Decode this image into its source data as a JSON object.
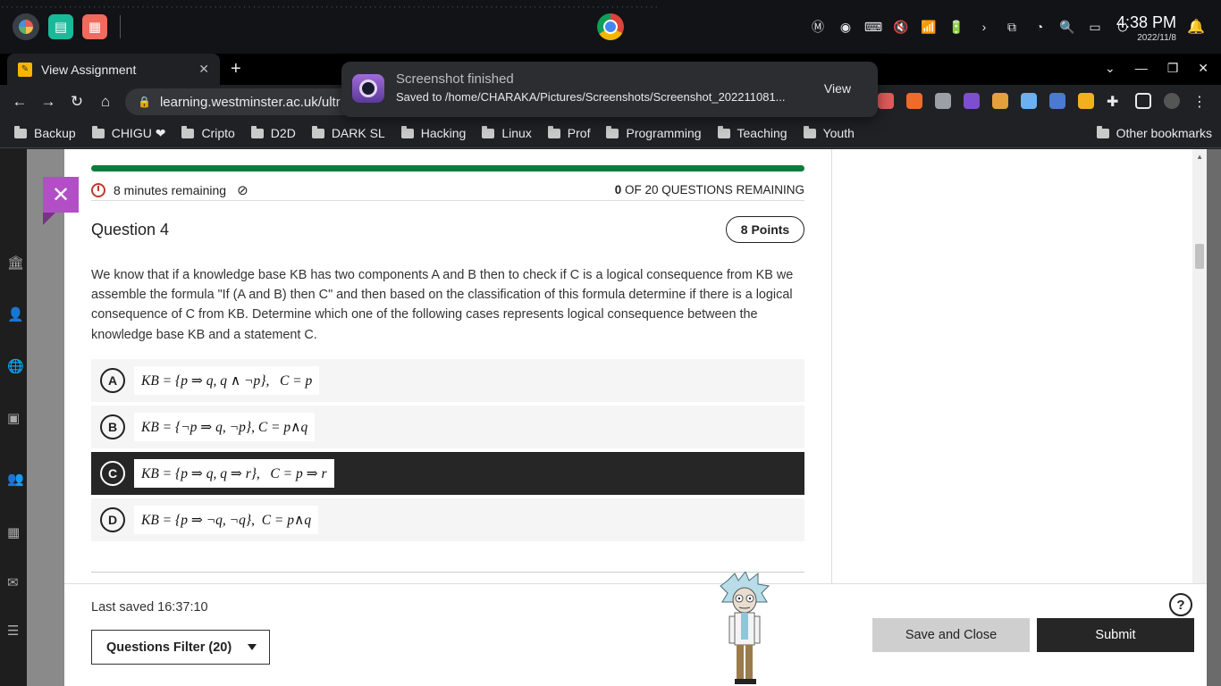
{
  "os": {
    "time": "4:38 PM",
    "date": "2022/11/8"
  },
  "browser": {
    "tab_title": "View Assignment",
    "url": "learning.westminster.ac.uk/ultr",
    "bookmarks": [
      "Backup",
      "CHIGU ❤",
      "Cripto",
      "D2D",
      "DARK SL",
      "Hacking",
      "Linux",
      "Prof",
      "Programming",
      "Teaching",
      "Youth"
    ],
    "other_bookmarks": "Other bookmarks"
  },
  "notification": {
    "title": "Screenshot finished",
    "body": "Saved to /home/CHARAKA/Pictures/Screenshots/Screenshot_202211081...",
    "action": "View"
  },
  "assessment": {
    "time_remaining": "8 minutes remaining",
    "questions_remaining_count": "0",
    "questions_remaining_text": "OF 20 QUESTIONS REMAINING",
    "question_title": "Question 4",
    "points": "8 Points",
    "question_text": "We know that if a knowledge base KB has two components A and B then to check if C is a logical consequence from KB we assemble the formula \"If (A and B) then C\" and then based on the classification of this formula determine if there is a logical consequence of C from KB. Determine which one of the following cases represents logical consequence between the knowledge base KB and a statement C.",
    "options": [
      {
        "letter": "A",
        "formula": "KB = {p ⇒ q, q ∧ ¬p},   C = p",
        "selected": false
      },
      {
        "letter": "B",
        "formula": "KB = {¬p ⇒ q, ¬p}, C = p∧q",
        "selected": false
      },
      {
        "letter": "C",
        "formula": "KB = {p ⇒ q, q ⇒ r},   C = p ⇒ r",
        "selected": true
      },
      {
        "letter": "D",
        "formula": "KB = {p ⇒ ¬q, ¬q},  C = p∧q",
        "selected": false
      }
    ]
  },
  "footer": {
    "last_saved": "Last saved 16:37:10",
    "questions_filter": "Questions Filter (20)",
    "save_close": "Save and Close",
    "submit": "Submit"
  },
  "colors": {
    "progress": "#0a7d3b",
    "close_accent": "#b24fc7",
    "selected_option": "#262626"
  }
}
